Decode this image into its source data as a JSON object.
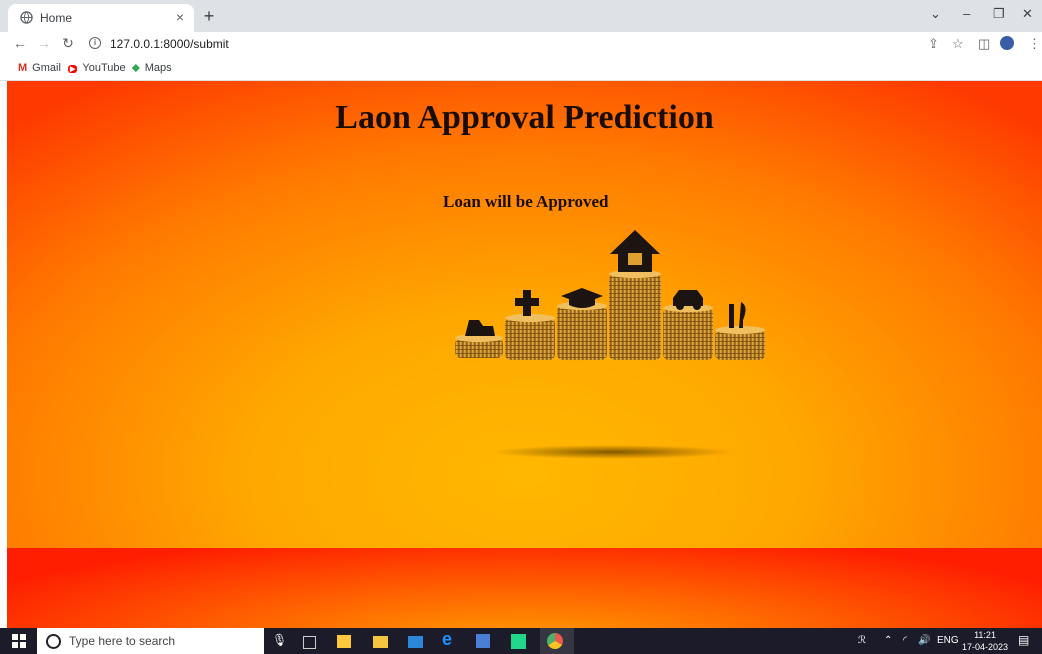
{
  "browser": {
    "tab_title": "Home",
    "tab_close": "×",
    "new_tab": "+",
    "url": "127.0.0.1:8000/submit",
    "window_controls": {
      "minimize": "–",
      "restore": "❐",
      "close": "✕",
      "dropdown": "⌄"
    },
    "bookmarks": [
      {
        "label": "Gmail",
        "icon": "gmail-icon",
        "color": "#d93025"
      },
      {
        "label": "YouTube",
        "icon": "youtube-icon",
        "color": "#ff0000"
      },
      {
        "label": "Maps",
        "icon": "maps-icon",
        "color": "#1a73e8"
      }
    ]
  },
  "page": {
    "heading": "Laon Approval Prediction",
    "result": "Loan will be Approved",
    "colors": {
      "outer": "#ff2a00",
      "inner": "#ffb300",
      "text": "#1a0d00"
    }
  },
  "taskbar": {
    "search_placeholder": "Type here to search",
    "tray_lang": "ENG",
    "time": "11:21",
    "date": "17-04-2023"
  }
}
